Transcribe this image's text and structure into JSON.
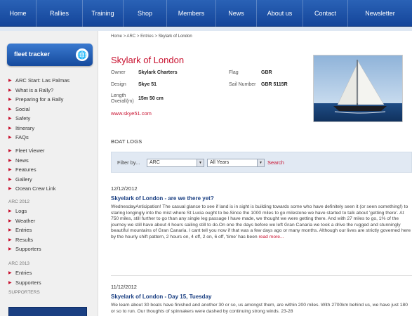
{
  "nav": {
    "items": [
      "Home",
      "Rallies",
      "Training",
      "Shop",
      "Members",
      "News",
      "About us",
      "Contact",
      "Newsletter"
    ]
  },
  "sidebar": {
    "fleet_tracker_label": "fleet tracker",
    "group1": [
      "ARC Start: Las Palmas",
      "What is a Rally?",
      "Preparing for a Rally",
      "Social",
      "Safety",
      "Itinerary",
      "FAQs"
    ],
    "group2": [
      "Fleet Viewer",
      "News",
      "Features",
      "Gallery",
      "Ocean Crew Link"
    ],
    "heading_arc2012": "ARC 2012",
    "group3": [
      "Logs",
      "Weather",
      "Entries",
      "Results",
      "Supporters"
    ],
    "heading_arc2013": "ARC 2013",
    "group4": [
      "Entries",
      "Supporters"
    ],
    "heading_supporters": "SUPPORTERS"
  },
  "breadcrumb": {
    "home": "Home",
    "arc": "ARC",
    "entries": "Entries",
    "current": "Skylark of London",
    "sep": ">"
  },
  "boat": {
    "title": "Skylark of London",
    "owner_label": "Owner",
    "owner": "Skylark Charters",
    "design_label": "Design",
    "design": "Skye 51",
    "length_label_1": "Length",
    "length_label_2": "Overall(m)",
    "length": "15m 50 cm",
    "flag_label": "Flag",
    "flag": "GBR",
    "sail_label": "Sail Number",
    "sail": "GBR 5115R",
    "website": "www.skye51.com"
  },
  "logs": {
    "heading": "BOAT LOGS",
    "filter_label": "Filter by...",
    "filter_rally": "ARC",
    "filter_year": "All Years",
    "search_label": "Search",
    "posts": [
      {
        "date": "12/12/2012",
        "title": "Skyelark of London - are we there yet?",
        "body": "WednesdayAnticipation! The casual glance to see if land is in sight is building towards some who have definitely seen it (or seen something!) to staring longingly into the mist where St Lucia ought to be.Since the 1000 miles to go milestone we have started to talk about 'getting there'. At 750 miles, still further to go than any single leg passage I have made, we thought we were getting there. And with 27 miles to go, 1% of the journey we still have about 4 hours sailing still to do.On one the days before we left Gran Canaria we took a drive the rugged and stunningly beautiful mountains of Gran Canaria. I cant tell you now if that was a few days ago or many months. Although our lives are strictly governed here by the hourly shift pattern, 2 hours on, 4 off, 2 on, 6 off, 'time' has been",
        "read_more": "read more..."
      },
      {
        "date": "11/12/2012",
        "title": "Skyelark of London - Day 15, Tuesday",
        "body": "We learn about 30 boats have finished and another 30 or so, us amongst them, are within 200 miles. With 2700km behind us, we have just 180 or so to run. Our thoughts of spinnakers were dashed by continuing strong winds. 23-28"
      }
    ]
  },
  "colors": {
    "nav_blue": "#1a4fa3",
    "accent_red": "#c8102e",
    "link_blue": "#1a3f82"
  }
}
